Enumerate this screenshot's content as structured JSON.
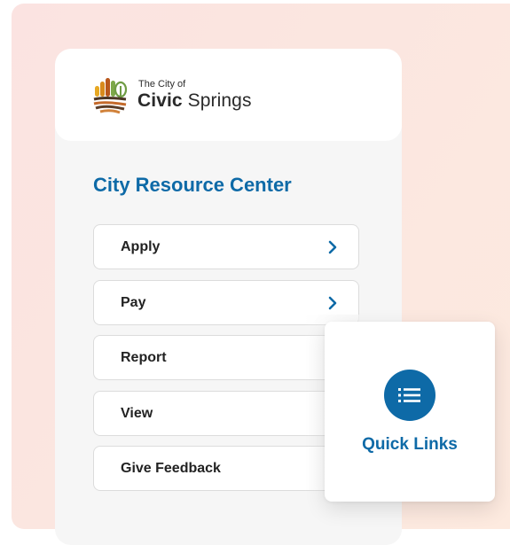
{
  "branding": {
    "tagline": "The City of",
    "name_bold": "Civic",
    "name_rest": " Springs"
  },
  "resource_center": {
    "title": "City Resource Center",
    "items": [
      {
        "label": "Apply",
        "has_chevron": true
      },
      {
        "label": "Pay",
        "has_chevron": true
      },
      {
        "label": "Report",
        "has_chevron": false
      },
      {
        "label": "View",
        "has_chevron": false
      },
      {
        "label": "Give Feedback",
        "has_chevron": false
      }
    ]
  },
  "quick_links": {
    "label": "Quick Links",
    "icon": "list-icon"
  },
  "colors": {
    "accent": "#0e6aa7",
    "background_gradient_start": "#fbe3e1",
    "background_gradient_end": "#fdeadf"
  }
}
